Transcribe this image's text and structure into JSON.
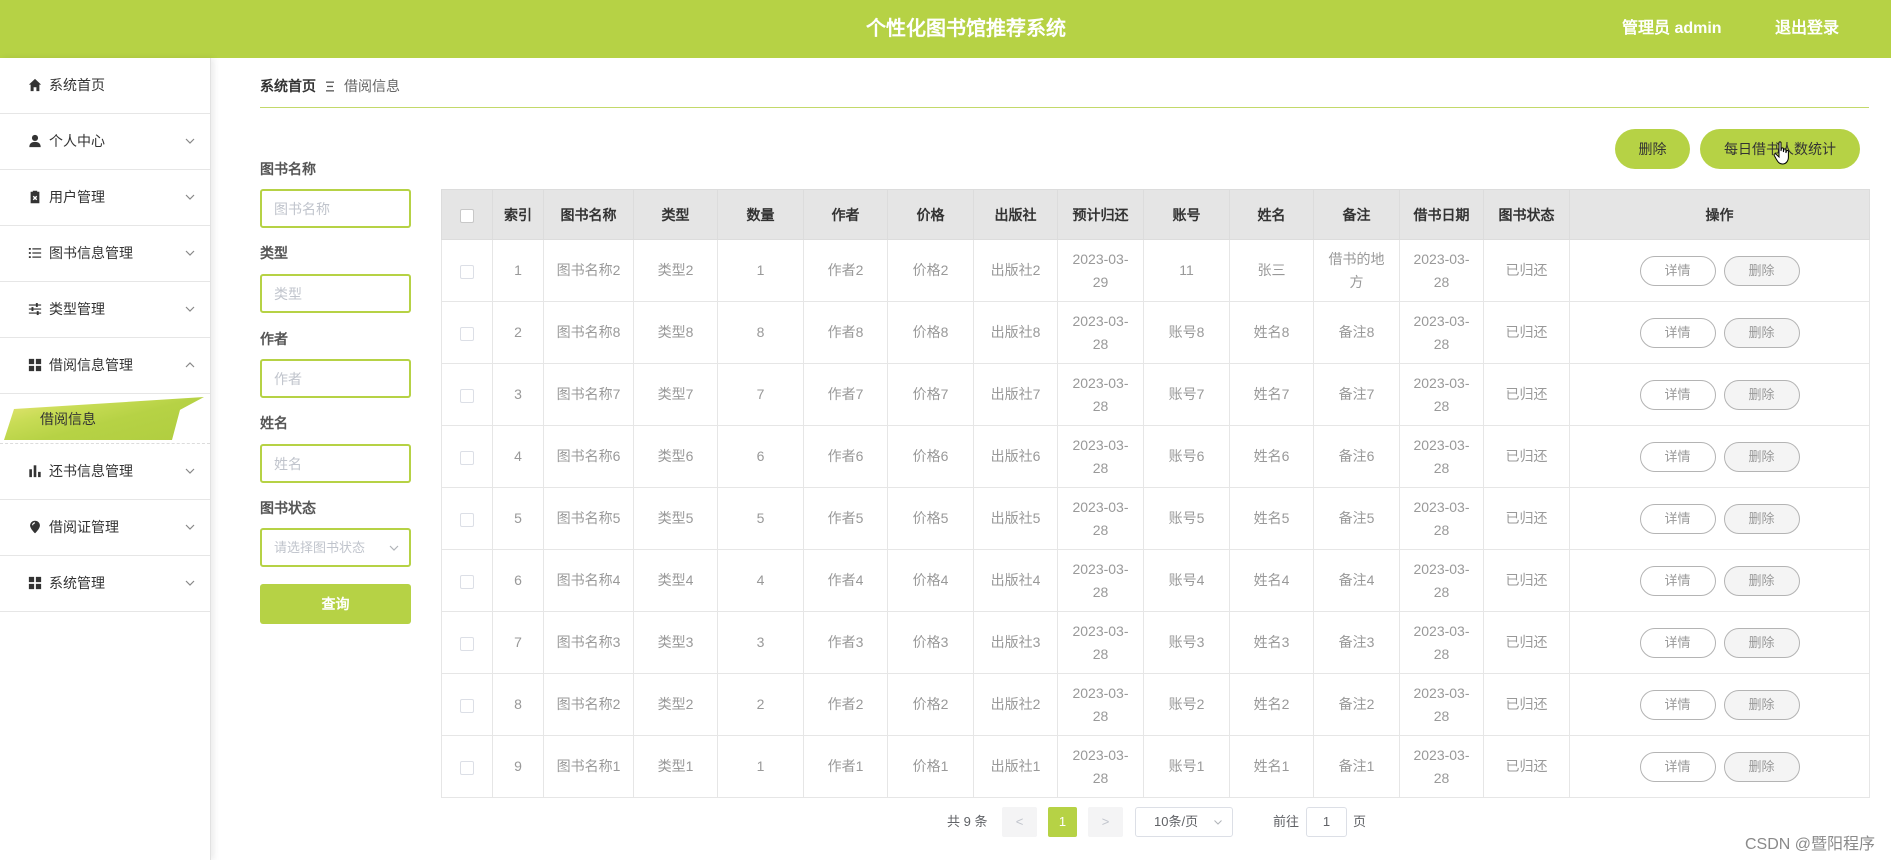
{
  "header": {
    "title": "个性化图书馆推荐系统",
    "user": "管理员 admin",
    "logout": "退出登录"
  },
  "sidebar": {
    "items": [
      {
        "label": "系统首页",
        "icon": "home-icon"
      },
      {
        "label": "个人中心",
        "icon": "user-icon"
      },
      {
        "label": "用户管理",
        "icon": "clipboard-icon"
      },
      {
        "label": "图书信息管理",
        "icon": "list-icon"
      },
      {
        "label": "类型管理",
        "icon": "sliders-icon"
      },
      {
        "label": "借阅信息管理",
        "icon": "grid-icon",
        "expanded": true,
        "children": [
          {
            "label": "借阅信息",
            "active": true
          }
        ]
      },
      {
        "label": "还书信息管理",
        "icon": "bar-chart-icon"
      },
      {
        "label": "借阅证管理",
        "icon": "pin-icon"
      },
      {
        "label": "系统管理",
        "icon": "grid-icon"
      }
    ]
  },
  "breadcrumb": {
    "home": "系统首页",
    "separator_icon": "separator-icon",
    "current": "借阅信息"
  },
  "toolbar": {
    "delete": "删除",
    "stats": "每日借书人数统计"
  },
  "filters": {
    "book_name": {
      "label": "图书名称",
      "placeholder": "图书名称"
    },
    "type": {
      "label": "类型",
      "placeholder": "类型"
    },
    "author": {
      "label": "作者",
      "placeholder": "作者"
    },
    "name": {
      "label": "姓名",
      "placeholder": "姓名"
    },
    "status": {
      "label": "图书状态",
      "placeholder": "请选择图书状态"
    },
    "search_button": "查询"
  },
  "table": {
    "columns": [
      "索引",
      "图书名称",
      "类型",
      "数量",
      "作者",
      "价格",
      "出版社",
      "预计归还",
      "账号",
      "姓名",
      "备注",
      "借书日期",
      "图书状态",
      "操作"
    ],
    "rows": [
      {
        "index": 1,
        "book_name": "图书名称2",
        "type": "类型2",
        "quantity": 1,
        "author": "作者2",
        "price": "价格2",
        "publisher": "出版社2",
        "due_date": "2023-03-29",
        "account": "11",
        "name": "张三",
        "remark": "借书的地方",
        "borrow_date": "2023-03-28",
        "status": "已归还"
      },
      {
        "index": 2,
        "book_name": "图书名称8",
        "type": "类型8",
        "quantity": 8,
        "author": "作者8",
        "price": "价格8",
        "publisher": "出版社8",
        "due_date": "2023-03-28",
        "account": "账号8",
        "name": "姓名8",
        "remark": "备注8",
        "borrow_date": "2023-03-28",
        "status": "已归还"
      },
      {
        "index": 3,
        "book_name": "图书名称7",
        "type": "类型7",
        "quantity": 7,
        "author": "作者7",
        "price": "价格7",
        "publisher": "出版社7",
        "due_date": "2023-03-28",
        "account": "账号7",
        "name": "姓名7",
        "remark": "备注7",
        "borrow_date": "2023-03-28",
        "status": "已归还"
      },
      {
        "index": 4,
        "book_name": "图书名称6",
        "type": "类型6",
        "quantity": 6,
        "author": "作者6",
        "price": "价格6",
        "publisher": "出版社6",
        "due_date": "2023-03-28",
        "account": "账号6",
        "name": "姓名6",
        "remark": "备注6",
        "borrow_date": "2023-03-28",
        "status": "已归还"
      },
      {
        "index": 5,
        "book_name": "图书名称5",
        "type": "类型5",
        "quantity": 5,
        "author": "作者5",
        "price": "价格5",
        "publisher": "出版社5",
        "due_date": "2023-03-28",
        "account": "账号5",
        "name": "姓名5",
        "remark": "备注5",
        "borrow_date": "2023-03-28",
        "status": "已归还"
      },
      {
        "index": 6,
        "book_name": "图书名称4",
        "type": "类型4",
        "quantity": 4,
        "author": "作者4",
        "price": "价格4",
        "publisher": "出版社4",
        "due_date": "2023-03-28",
        "account": "账号4",
        "name": "姓名4",
        "remark": "备注4",
        "borrow_date": "2023-03-28",
        "status": "已归还"
      },
      {
        "index": 7,
        "book_name": "图书名称3",
        "type": "类型3",
        "quantity": 3,
        "author": "作者3",
        "price": "价格3",
        "publisher": "出版社3",
        "due_date": "2023-03-28",
        "account": "账号3",
        "name": "姓名3",
        "remark": "备注3",
        "borrow_date": "2023-03-28",
        "status": "已归还"
      },
      {
        "index": 8,
        "book_name": "图书名称2",
        "type": "类型2",
        "quantity": 2,
        "author": "作者2",
        "price": "价格2",
        "publisher": "出版社2",
        "due_date": "2023-03-28",
        "account": "账号2",
        "name": "姓名2",
        "remark": "备注2",
        "borrow_date": "2023-03-28",
        "status": "已归还"
      },
      {
        "index": 9,
        "book_name": "图书名称1",
        "type": "类型1",
        "quantity": 1,
        "author": "作者1",
        "price": "价格1",
        "publisher": "出版社1",
        "due_date": "2023-03-28",
        "account": "账号1",
        "name": "姓名1",
        "remark": "备注1",
        "borrow_date": "2023-03-28",
        "status": "已归还"
      }
    ],
    "actions": {
      "detail": "详情",
      "delete": "删除"
    }
  },
  "pagination": {
    "total": "共 9 条",
    "prev": "<",
    "current_page": "1",
    "next": ">",
    "page_size": "10条/页",
    "goto_label": "前往",
    "goto_value": "1",
    "page_suffix": "页"
  },
  "watermark": "CSDN @暨阳程序",
  "colors": {
    "accent": "#b6d245",
    "table_header_bg": "#e5e5e5",
    "muted_text": "#999999"
  }
}
